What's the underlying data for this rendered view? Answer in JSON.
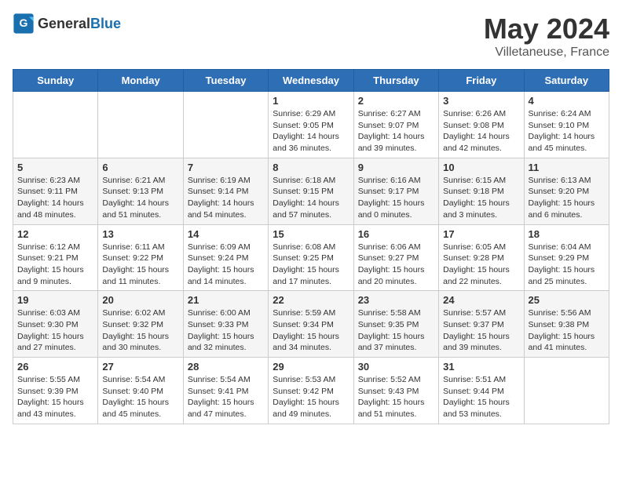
{
  "header": {
    "logo_general": "General",
    "logo_blue": "Blue",
    "month": "May 2024",
    "location": "Villetaneuse, France"
  },
  "weekdays": [
    "Sunday",
    "Monday",
    "Tuesday",
    "Wednesday",
    "Thursday",
    "Friday",
    "Saturday"
  ],
  "weeks": [
    [
      {
        "day": "",
        "info": ""
      },
      {
        "day": "",
        "info": ""
      },
      {
        "day": "",
        "info": ""
      },
      {
        "day": "1",
        "info": "Sunrise: 6:29 AM\nSunset: 9:05 PM\nDaylight: 14 hours\nand 36 minutes."
      },
      {
        "day": "2",
        "info": "Sunrise: 6:27 AM\nSunset: 9:07 PM\nDaylight: 14 hours\nand 39 minutes."
      },
      {
        "day": "3",
        "info": "Sunrise: 6:26 AM\nSunset: 9:08 PM\nDaylight: 14 hours\nand 42 minutes."
      },
      {
        "day": "4",
        "info": "Sunrise: 6:24 AM\nSunset: 9:10 PM\nDaylight: 14 hours\nand 45 minutes."
      }
    ],
    [
      {
        "day": "5",
        "info": "Sunrise: 6:23 AM\nSunset: 9:11 PM\nDaylight: 14 hours\nand 48 minutes."
      },
      {
        "day": "6",
        "info": "Sunrise: 6:21 AM\nSunset: 9:13 PM\nDaylight: 14 hours\nand 51 minutes."
      },
      {
        "day": "7",
        "info": "Sunrise: 6:19 AM\nSunset: 9:14 PM\nDaylight: 14 hours\nand 54 minutes."
      },
      {
        "day": "8",
        "info": "Sunrise: 6:18 AM\nSunset: 9:15 PM\nDaylight: 14 hours\nand 57 minutes."
      },
      {
        "day": "9",
        "info": "Sunrise: 6:16 AM\nSunset: 9:17 PM\nDaylight: 15 hours\nand 0 minutes."
      },
      {
        "day": "10",
        "info": "Sunrise: 6:15 AM\nSunset: 9:18 PM\nDaylight: 15 hours\nand 3 minutes."
      },
      {
        "day": "11",
        "info": "Sunrise: 6:13 AM\nSunset: 9:20 PM\nDaylight: 15 hours\nand 6 minutes."
      }
    ],
    [
      {
        "day": "12",
        "info": "Sunrise: 6:12 AM\nSunset: 9:21 PM\nDaylight: 15 hours\nand 9 minutes."
      },
      {
        "day": "13",
        "info": "Sunrise: 6:11 AM\nSunset: 9:22 PM\nDaylight: 15 hours\nand 11 minutes."
      },
      {
        "day": "14",
        "info": "Sunrise: 6:09 AM\nSunset: 9:24 PM\nDaylight: 15 hours\nand 14 minutes."
      },
      {
        "day": "15",
        "info": "Sunrise: 6:08 AM\nSunset: 9:25 PM\nDaylight: 15 hours\nand 17 minutes."
      },
      {
        "day": "16",
        "info": "Sunrise: 6:06 AM\nSunset: 9:27 PM\nDaylight: 15 hours\nand 20 minutes."
      },
      {
        "day": "17",
        "info": "Sunrise: 6:05 AM\nSunset: 9:28 PM\nDaylight: 15 hours\nand 22 minutes."
      },
      {
        "day": "18",
        "info": "Sunrise: 6:04 AM\nSunset: 9:29 PM\nDaylight: 15 hours\nand 25 minutes."
      }
    ],
    [
      {
        "day": "19",
        "info": "Sunrise: 6:03 AM\nSunset: 9:30 PM\nDaylight: 15 hours\nand 27 minutes."
      },
      {
        "day": "20",
        "info": "Sunrise: 6:02 AM\nSunset: 9:32 PM\nDaylight: 15 hours\nand 30 minutes."
      },
      {
        "day": "21",
        "info": "Sunrise: 6:00 AM\nSunset: 9:33 PM\nDaylight: 15 hours\nand 32 minutes."
      },
      {
        "day": "22",
        "info": "Sunrise: 5:59 AM\nSunset: 9:34 PM\nDaylight: 15 hours\nand 34 minutes."
      },
      {
        "day": "23",
        "info": "Sunrise: 5:58 AM\nSunset: 9:35 PM\nDaylight: 15 hours\nand 37 minutes."
      },
      {
        "day": "24",
        "info": "Sunrise: 5:57 AM\nSunset: 9:37 PM\nDaylight: 15 hours\nand 39 minutes."
      },
      {
        "day": "25",
        "info": "Sunrise: 5:56 AM\nSunset: 9:38 PM\nDaylight: 15 hours\nand 41 minutes."
      }
    ],
    [
      {
        "day": "26",
        "info": "Sunrise: 5:55 AM\nSunset: 9:39 PM\nDaylight: 15 hours\nand 43 minutes."
      },
      {
        "day": "27",
        "info": "Sunrise: 5:54 AM\nSunset: 9:40 PM\nDaylight: 15 hours\nand 45 minutes."
      },
      {
        "day": "28",
        "info": "Sunrise: 5:54 AM\nSunset: 9:41 PM\nDaylight: 15 hours\nand 47 minutes."
      },
      {
        "day": "29",
        "info": "Sunrise: 5:53 AM\nSunset: 9:42 PM\nDaylight: 15 hours\nand 49 minutes."
      },
      {
        "day": "30",
        "info": "Sunrise: 5:52 AM\nSunset: 9:43 PM\nDaylight: 15 hours\nand 51 minutes."
      },
      {
        "day": "31",
        "info": "Sunrise: 5:51 AM\nSunset: 9:44 PM\nDaylight: 15 hours\nand 53 minutes."
      },
      {
        "day": "",
        "info": ""
      }
    ]
  ]
}
